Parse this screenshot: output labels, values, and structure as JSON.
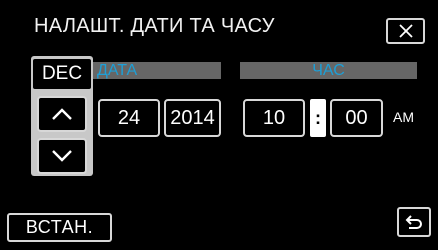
{
  "title": "НАЛАШТ. ДАТИ ТА ЧАСУ",
  "header": {
    "close_icon": "close-icon"
  },
  "date_section": {
    "label": "ДАТА",
    "month": "DEC",
    "day": "24",
    "year": "2014",
    "up_icon": "chevron-up-icon",
    "down_icon": "chevron-down-icon"
  },
  "time_section": {
    "label": "ЧАС",
    "hour": "10",
    "separator": ":",
    "minute": "00",
    "period": "AM"
  },
  "footer": {
    "set_label": "ВСТАН.",
    "back_icon": "return-icon"
  },
  "colors": {
    "background": "#000000",
    "label_blue": "#1e9fd6",
    "label_bar_gray": "#666666",
    "border": "#d8d8d8"
  }
}
